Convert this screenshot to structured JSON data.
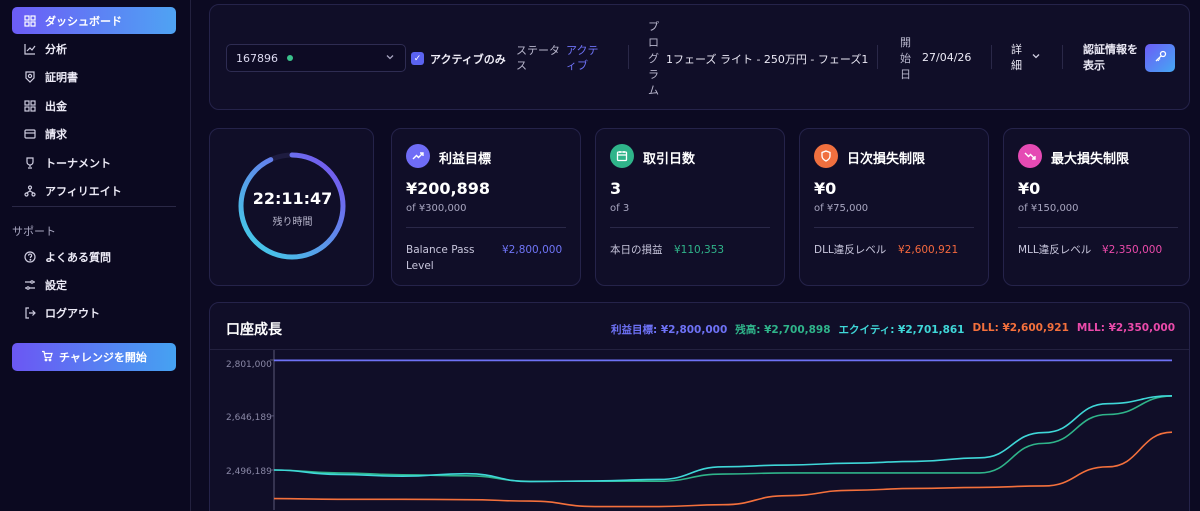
{
  "sidebar": {
    "items": [
      {
        "label": "ダッシュボード",
        "icon": "grid-icon",
        "active": true
      },
      {
        "label": "分析",
        "icon": "chart-icon"
      },
      {
        "label": "証明書",
        "icon": "badge-icon"
      },
      {
        "label": "出金",
        "icon": "grid-icon"
      },
      {
        "label": "請求",
        "icon": "card-icon"
      },
      {
        "label": "トーナメント",
        "icon": "trophy-icon"
      },
      {
        "label": "アフィリエイト",
        "icon": "network-icon"
      }
    ],
    "support_heading": "サポート",
    "support_items": [
      {
        "label": "よくある質問",
        "icon": "help-icon"
      },
      {
        "label": "設定",
        "icon": "settings-icon"
      },
      {
        "label": "ログアウト",
        "icon": "logout-icon"
      }
    ],
    "cta_label": "チャレンジを開始"
  },
  "topbar": {
    "account_id": "167896",
    "active_only_label": "アクティブのみ",
    "status_label": "ステータス",
    "status_value": "アクティブ",
    "program_label": "プログラム",
    "program_value": "1フェーズ ライト - 250万円 - フェーズ1",
    "start_label": "開始日",
    "start_value": "27/04/26",
    "detail_label": "詳細",
    "auth_label": "認証情報を表示"
  },
  "timer": {
    "time": "22:11:47",
    "label": "残り時間",
    "progress": 0.93
  },
  "cards": [
    {
      "title": "利益目標",
      "value": "¥200,898",
      "sub": "of ¥300,000",
      "k": "Balance Pass Level",
      "v": "¥2,800,000",
      "icon": "trend-up-icon",
      "icon_color": "#6f6cf6",
      "v_color": "#6f74f6"
    },
    {
      "title": "取引日数",
      "value": "3",
      "sub": "of 3",
      "k": "本日の損益",
      "v": "¥110,353",
      "icon": "calendar-icon",
      "icon_color": "#2fb48a",
      "v_color": "#2fb48a"
    },
    {
      "title": "日次損失制限",
      "value": "¥0",
      "sub": "of ¥75,000",
      "k": "DLL違反レベル",
      "v": "¥2,600,921",
      "icon": "shield-icon",
      "icon_color": "#f0703f",
      "v_color": "#f4683e"
    },
    {
      "title": "最大損失制限",
      "value": "¥0",
      "sub": "of ¥150,000",
      "k": "MLL違反レベル",
      "v": "¥2,350,000",
      "icon": "trend-down-icon",
      "icon_color": "#e54ab4",
      "v_color": "#ea4aaa"
    }
  ],
  "chart": {
    "title": "口座成長",
    "legend": [
      {
        "text": "利益目標: ¥2,800,000",
        "color": "#6e72f6"
      },
      {
        "text": "残高: ¥2,700,898",
        "color": "#2fb48a"
      },
      {
        "text": "エクイティ: ¥2,701,861",
        "color": "#3fd7d8"
      },
      {
        "text": "DLL: ¥2,600,921",
        "color": "#f4703c"
      },
      {
        "text": "MLL: ¥2,350,000",
        "color": "#ea4aaa"
      }
    ],
    "yticks": [
      "2,801,000",
      "2,646,189",
      "2,496,189"
    ]
  },
  "chart_data": {
    "type": "line",
    "title": "口座成長",
    "x": [
      0,
      1,
      2,
      3,
      4,
      5,
      6,
      7,
      8,
      9,
      10,
      11,
      12,
      13,
      14
    ],
    "ylim": [
      2400000,
      2801000
    ],
    "yticks": [
      2801000,
      2646189,
      2496189
    ],
    "series": [
      {
        "name": "利益目標",
        "color": "#6e72f6",
        "values": [
          2800000,
          2800000,
          2800000,
          2800000,
          2800000,
          2800000,
          2800000,
          2800000,
          2800000,
          2800000,
          2800000,
          2800000,
          2800000,
          2800000,
          2800000
        ]
      },
      {
        "name": "残高",
        "color": "#2fb48a",
        "values": [
          2496189,
          2488000,
          2483000,
          2480000,
          2465000,
          2465000,
          2465000,
          2485000,
          2488000,
          2488000,
          2488000,
          2488000,
          2570000,
          2650000,
          2700898
        ]
      },
      {
        "name": "エクイティ",
        "color": "#3fd7d8",
        "values": [
          2496189,
          2484000,
          2479000,
          2486000,
          2464000,
          2466000,
          2470000,
          2505000,
          2510000,
          2515000,
          2520000,
          2530000,
          2600000,
          2680000,
          2701861
        ]
      },
      {
        "name": "DLL",
        "color": "#f4703c",
        "values": [
          2417000,
          2415000,
          2415000,
          2414000,
          2410000,
          2395000,
          2395000,
          2400000,
          2425000,
          2440000,
          2445000,
          2448000,
          2452000,
          2505000,
          2600921
        ]
      }
    ]
  }
}
